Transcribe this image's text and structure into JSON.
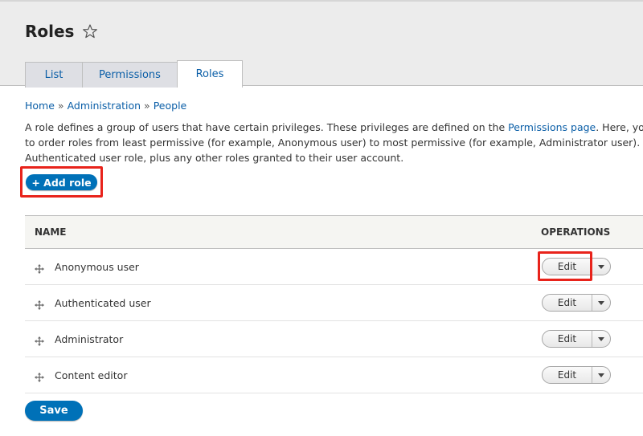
{
  "header": {
    "title": "Roles",
    "tabs": [
      {
        "label": "List"
      },
      {
        "label": "Permissions"
      },
      {
        "label": "Roles"
      }
    ]
  },
  "breadcrumb": {
    "items": [
      "Home",
      "Administration",
      "People"
    ],
    "separator": "»"
  },
  "description": {
    "line1_before_link": "A role defines a group of users that have certain privileges. These privileges are defined on the ",
    "link": "Permissions page",
    "line1_after_link": ". Here, you can",
    "line2": "to order roles from least permissive (for example, Anonymous user) to most permissive (for example, Administrator user). Users",
    "line3": "Authenticated user role, plus any other roles granted to their user account."
  },
  "add_role_label": "+ Add role",
  "table": {
    "headers": {
      "name": "NAME",
      "operations": "OPERATIONS"
    },
    "rows": [
      {
        "name": "Anonymous user",
        "op": "Edit"
      },
      {
        "name": "Authenticated user",
        "op": "Edit"
      },
      {
        "name": "Administrator",
        "op": "Edit"
      },
      {
        "name": "Content editor",
        "op": "Edit"
      }
    ]
  },
  "save_label": "Save",
  "colors": {
    "link": "#0a5ea7",
    "primary_button": "#0071b8",
    "highlight": "#e8231b"
  }
}
